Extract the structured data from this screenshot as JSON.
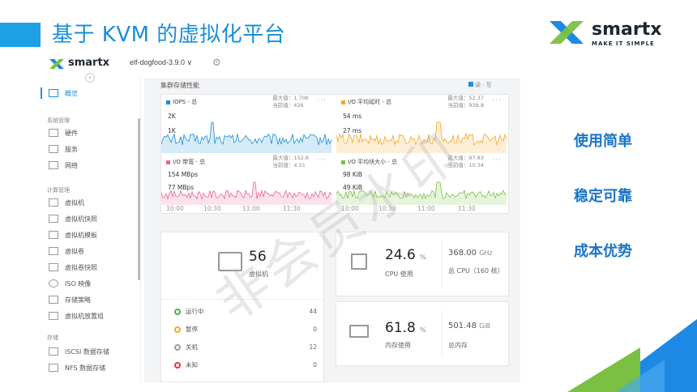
{
  "slide": {
    "title": "基于 KVM 的虚拟化平台",
    "brand": {
      "name": "smartx",
      "tagline": "MAKE IT SIMPLE"
    },
    "bullets": [
      "使用简单",
      "稳定可靠",
      "成本优势"
    ],
    "watermark": "非会员水印"
  },
  "colors": {
    "accent": "#1ea0e6",
    "brand_green": "#7ac143",
    "brand_blue": "#1e88e5"
  },
  "app": {
    "logo": "smartx",
    "cluster": "elf-dogfood-3.9.0 ∨",
    "icon_settings": "gear-icon",
    "sidebar": {
      "overview": "概览",
      "sec_system": "系统管理",
      "hardware": "硬件",
      "services": "服务",
      "network": "网络",
      "sec_compute": "计算管理",
      "vm": "虚拟机",
      "vm_snapshot": "虚拟机快照",
      "vm_template": "虚拟机模板",
      "volume": "虚拟卷",
      "volume_snapshot": "虚拟卷快照",
      "iso": "ISO 映像",
      "storage_policy": "存储策略",
      "vm_group": "虚拟机放置组",
      "sec_storage": "存储",
      "iscsi": "iSCSI 数据存储",
      "nfs": "NFS 数据存储"
    },
    "perf": {
      "title": "集群存储性能",
      "legend": "读 · 写",
      "iops": {
        "title": "IOPS - 总",
        "max": "最大值：1.70K",
        "cur": "当前值：426",
        "y1": "2K",
        "y2": "1K"
      },
      "latency": {
        "title": "I/O 平均延时 - 总",
        "max": "最大值：52.37",
        "cur": "当前值：938.8",
        "y1": "54 ms",
        "y2": "27 ms"
      },
      "bandwidth": {
        "title": "I/O 带宽 - 总",
        "max": "最大值：152.8",
        "cur": "当前值：4.51",
        "y1": "154 MBps",
        "y2": "77 MBps"
      },
      "blocksize": {
        "title": "I/O 平均块大小 - 总",
        "max": "最大值：97.83",
        "cur": "当前值：10.34",
        "y1": "98 KiB",
        "y2": "49 KiB"
      },
      "xticks": [
        "10:00",
        "10:30",
        "11:00",
        "11:30"
      ],
      "more": "···"
    },
    "vm": {
      "count": "56",
      "label": "虚拟机"
    },
    "status": [
      {
        "label": "运行中",
        "count": "44",
        "color": "#4caf50"
      },
      {
        "label": "暂停",
        "count": "0",
        "color": "#f5a623"
      },
      {
        "label": "关机",
        "count": "12",
        "color": "#9e9e9e"
      },
      {
        "label": "未知",
        "count": "0",
        "color": "#e53935"
      }
    ],
    "cpu": {
      "pct": "24.6",
      "unit": "%",
      "label": "CPU 使用",
      "total": "368.00",
      "total_unit": "GHz",
      "total_label": "总 CPU（160 核）"
    },
    "mem": {
      "pct": "61.8",
      "unit": "%",
      "label": "内存使用",
      "total": "501.48",
      "total_unit": "GiB",
      "total_label": "总内存"
    }
  }
}
